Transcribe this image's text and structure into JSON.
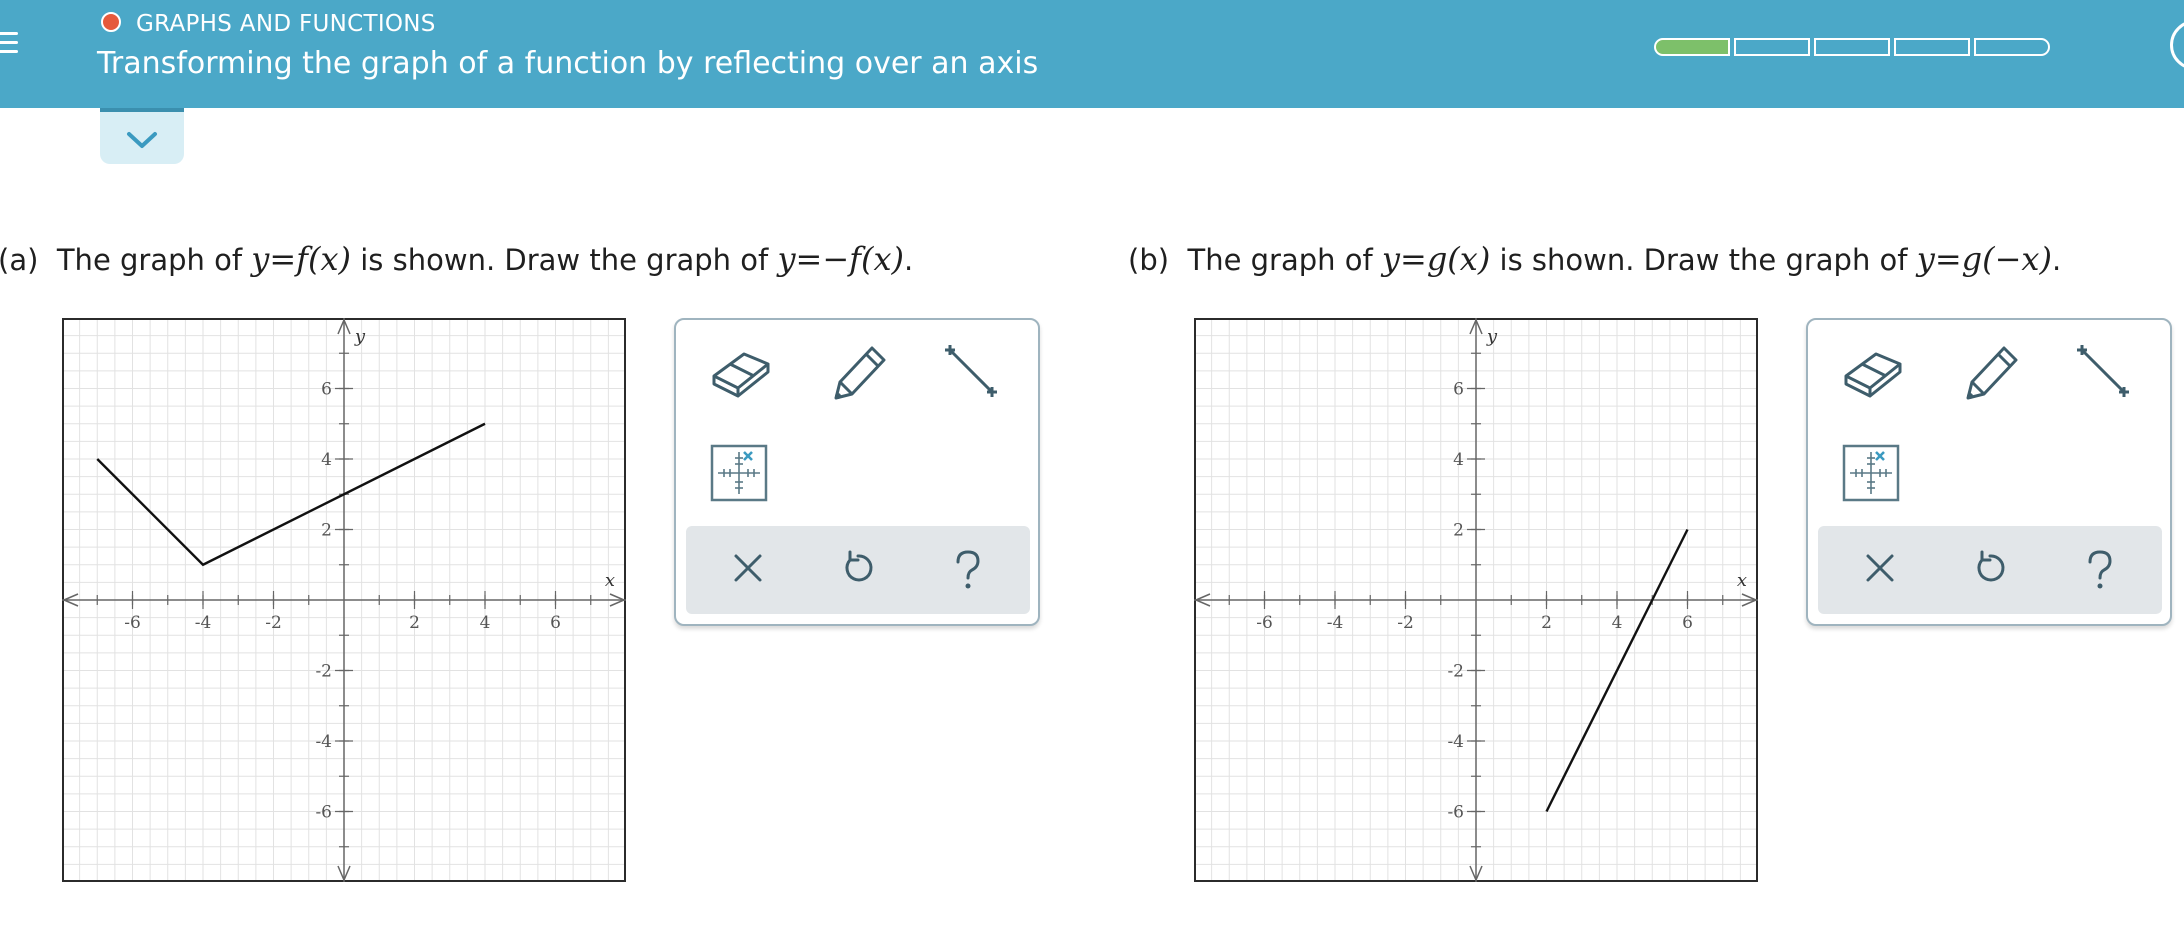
{
  "header": {
    "topic": "GRAPHS AND FUNCTIONS",
    "title": "Transforming the graph of a function by reflecting over an axis",
    "progress": {
      "total_segments": 5,
      "completed_segments": 1
    }
  },
  "colors": {
    "header_bg": "#4ba8c8",
    "topic_dot": "#e55a3c",
    "progress_fill": "#7dc06a",
    "tool_icon": "#3e5d6b",
    "action_bar": "#e2e6e9"
  },
  "part_a": {
    "label": "(a)",
    "text_1": "The graph of",
    "math_1": "y=f(x)",
    "text_2": "is shown. Draw the graph of",
    "math_2": "y=−f(x)",
    "text_3": "."
  },
  "part_b": {
    "label": "(b)",
    "text_1": "The graph of",
    "math_1": "y=g(x)",
    "text_2": "is shown. Draw the graph of",
    "math_2": "y=g(−x)",
    "text_3": "."
  },
  "chart_data": [
    {
      "type": "line",
      "xlim": [
        -8,
        8
      ],
      "ylim": [
        -8,
        8
      ],
      "xlabel": "x",
      "ylabel": "y",
      "x_ticks": [
        -6,
        -4,
        -2,
        2,
        4,
        6
      ],
      "y_ticks": [
        6,
        4,
        2,
        -2,
        -4,
        -6
      ],
      "grid": true,
      "series": [
        {
          "x": [
            -7,
            -4,
            4
          ],
          "y": [
            4,
            1,
            5
          ]
        }
      ]
    },
    {
      "type": "line",
      "xlim": [
        -8,
        8
      ],
      "ylim": [
        -8,
        8
      ],
      "xlabel": "x",
      "ylabel": "y",
      "x_ticks": [
        -6,
        -4,
        -2,
        2,
        4,
        6
      ],
      "y_ticks": [
        6,
        4,
        2,
        -2,
        -4,
        -6
      ],
      "grid": true,
      "series": [
        {
          "x": [
            2,
            6
          ],
          "y": [
            -6,
            2
          ]
        }
      ]
    }
  ],
  "tools": [
    "eraser-icon",
    "pencil-icon",
    "line-segment-icon",
    "graph-point-icon"
  ],
  "actions": {
    "clear": "×",
    "undo": "↺",
    "help": "?"
  }
}
